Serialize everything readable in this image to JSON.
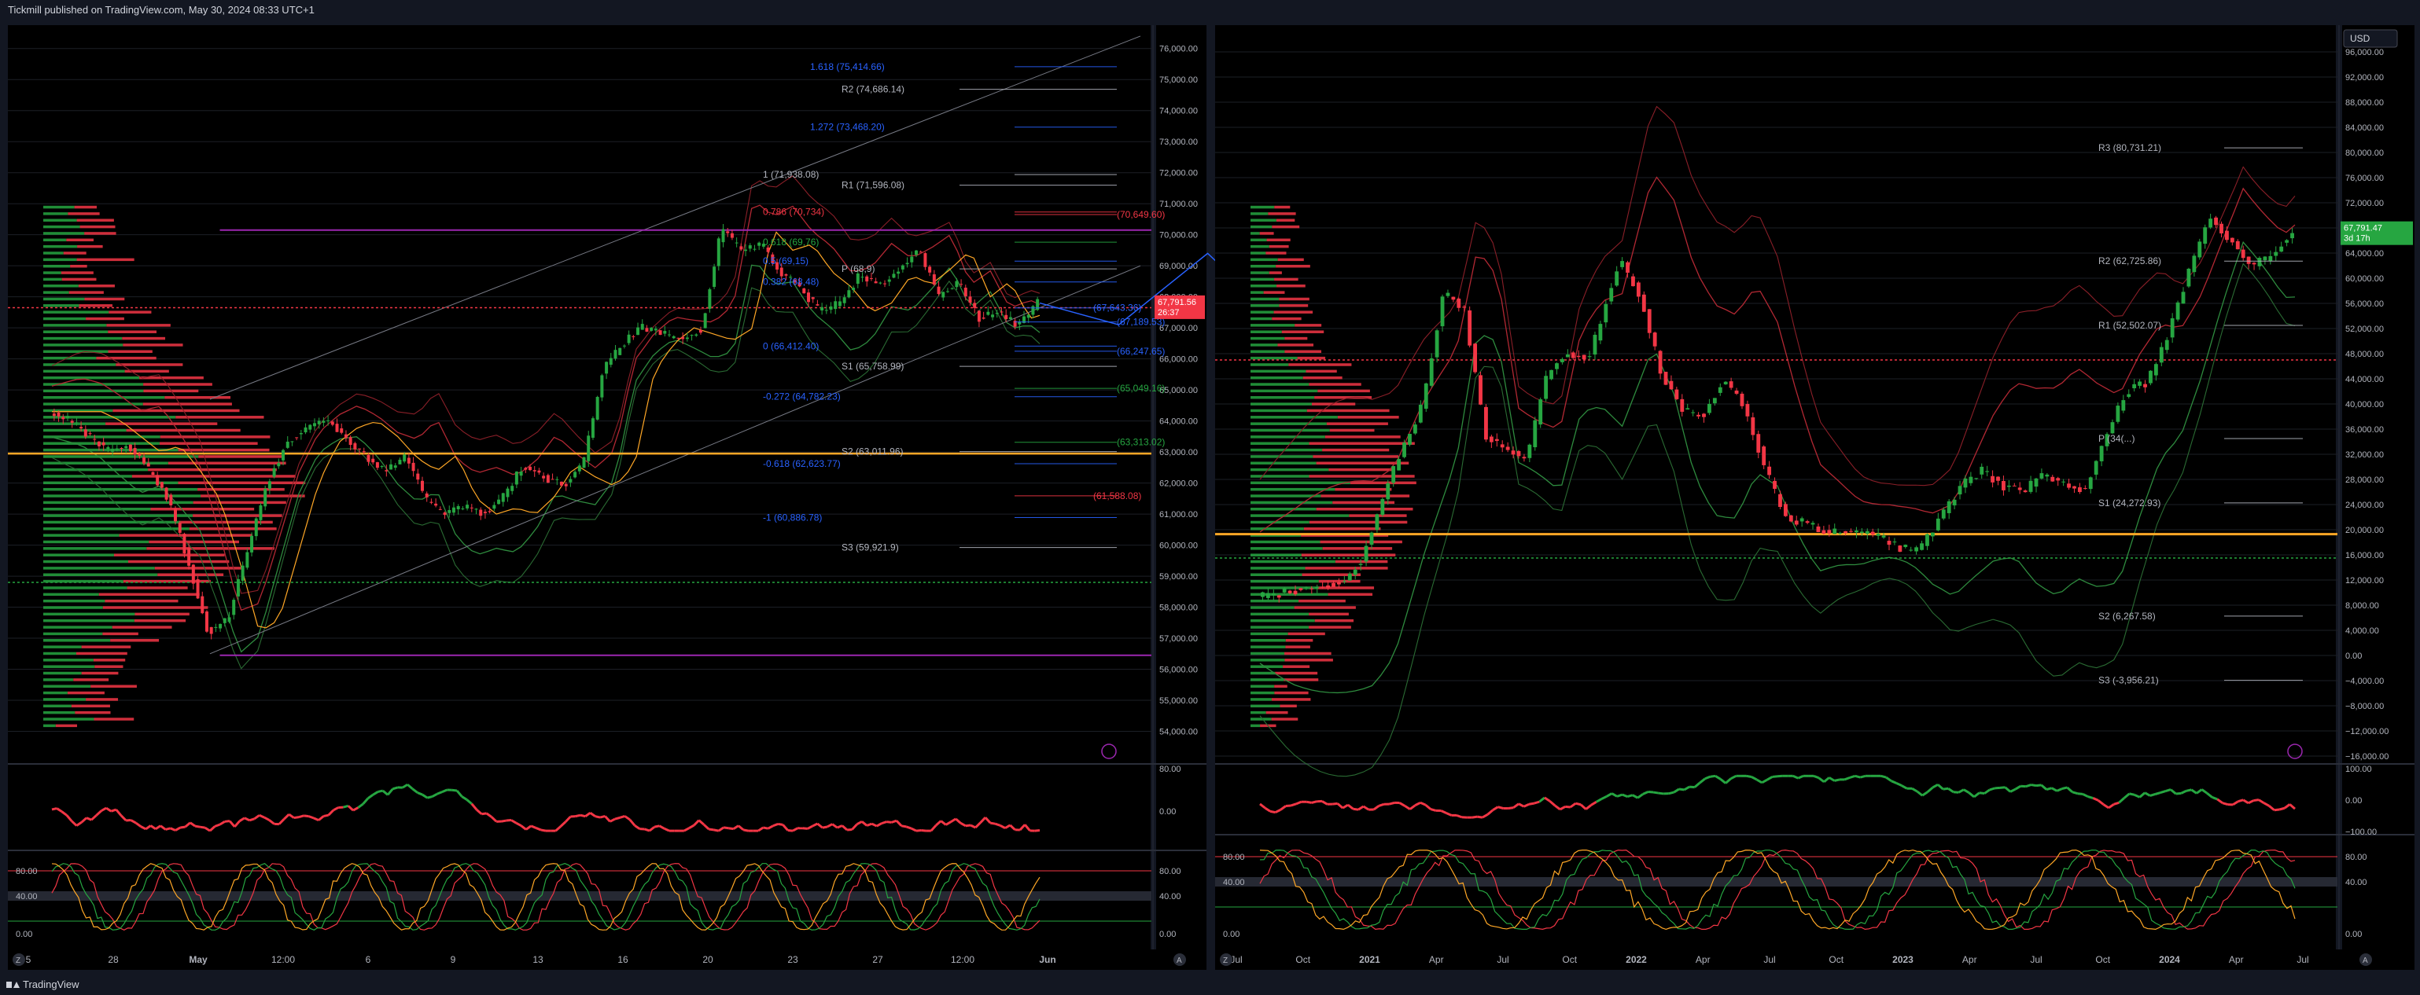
{
  "header": {
    "publisher": "Tickmill published on TradingView.com, May 30, 2024 08:33 UTC+1"
  },
  "footer": {
    "brand": "TradingView"
  },
  "colors": {
    "bg": "#000000",
    "up": "#26a641",
    "down": "#f23645",
    "grid": "#1c1f26",
    "axis_text": "#b2b5be",
    "fib": "#2962ff",
    "pivot": "#b2b5be",
    "channel": "#787b86",
    "purple": "#9c27b0",
    "orange": "#ffa726"
  },
  "chart_data": [
    {
      "name": "left-daily",
      "type": "line",
      "currency": "",
      "ylim": [
        53000,
        76500
      ],
      "y_ticks": [
        "76,000.00",
        "75,000.00",
        "74,000.00",
        "73,000.00",
        "72,000.00",
        "71,000.00",
        "70,000.00",
        "69,000.00",
        "68,000.00",
        "67,000.00",
        "66,000.00",
        "65,000.00",
        "64,000.00",
        "63,000.00",
        "62,000.00",
        "61,000.00",
        "60,000.00",
        "59,000.00",
        "58,000.00",
        "57,000.00",
        "56,000.00",
        "55,000.00",
        "54,000.00"
      ],
      "x_ticks": [
        "5",
        "28",
        "May",
        "12:00",
        "6",
        "9",
        "13",
        "16",
        "20",
        "23",
        "27",
        "12:00",
        "Jun"
      ],
      "last_price": {
        "value": 67791.56,
        "label": "67,791.56",
        "countdown": "26:37"
      },
      "price_path": [
        [
          0,
          64300
        ],
        [
          0.02,
          64000
        ],
        [
          0.04,
          63500
        ],
        [
          0.06,
          63000
        ],
        [
          0.08,
          63200
        ],
        [
          0.1,
          62400
        ],
        [
          0.12,
          61500
        ],
        [
          0.14,
          59500
        ],
        [
          0.16,
          57200
        ],
        [
          0.18,
          57600
        ],
        [
          0.2,
          59800
        ],
        [
          0.22,
          62000
        ],
        [
          0.24,
          63300
        ],
        [
          0.26,
          63800
        ],
        [
          0.28,
          64000
        ],
        [
          0.3,
          63500
        ],
        [
          0.32,
          62800
        ],
        [
          0.34,
          62400
        ],
        [
          0.36,
          62900
        ],
        [
          0.38,
          61500
        ],
        [
          0.4,
          61000
        ],
        [
          0.42,
          61200
        ],
        [
          0.44,
          61000
        ],
        [
          0.46,
          61600
        ],
        [
          0.48,
          62600
        ],
        [
          0.5,
          62200
        ],
        [
          0.52,
          61900
        ],
        [
          0.54,
          62600
        ],
        [
          0.56,
          65600
        ],
        [
          0.58,
          66500
        ],
        [
          0.6,
          67000
        ],
        [
          0.62,
          66800
        ],
        [
          0.64,
          66600
        ],
        [
          0.66,
          67000
        ],
        [
          0.68,
          70200
        ],
        [
          0.7,
          69500
        ],
        [
          0.72,
          69700
        ],
        [
          0.74,
          68800
        ],
        [
          0.76,
          68300
        ],
        [
          0.78,
          67500
        ],
        [
          0.8,
          67800
        ],
        [
          0.82,
          68700
        ],
        [
          0.84,
          68400
        ],
        [
          0.86,
          68900
        ],
        [
          0.88,
          69500
        ],
        [
          0.9,
          68000
        ],
        [
          0.92,
          68500
        ],
        [
          0.94,
          67300
        ],
        [
          0.96,
          67500
        ],
        [
          0.98,
          67100
        ],
        [
          1,
          67800
        ]
      ],
      "levels": [
        {
          "label": "1.618 (75,414.66)",
          "value": 75414.66,
          "kind": "fib"
        },
        {
          "label": "R2 (74,686.14)",
          "value": 74686.14,
          "kind": "pivot"
        },
        {
          "label": "1.272 (73,468.20)",
          "value": 73468.2,
          "kind": "fib"
        },
        {
          "label": "1 (71,938.08)",
          "value": 71938.08,
          "kind": "fib-main"
        },
        {
          "label": "R1 (71,596.08)",
          "value": 71596.08,
          "kind": "pivot"
        },
        {
          "label": "0.786 (70,734)",
          "value": 70734,
          "kind": "fib-red"
        },
        {
          "label": "(70,649.60)",
          "value": 70649.6,
          "kind": "red"
        },
        {
          "label": "0.618 (69,76)",
          "value": 69760,
          "kind": "fib-green"
        },
        {
          "label": "0.5 (69,15)",
          "value": 69150,
          "kind": "fib"
        },
        {
          "label": "P (68,9)",
          "value": 68900,
          "kind": "pivot"
        },
        {
          "label": "0.382 (68,48)",
          "value": 68480,
          "kind": "fib"
        },
        {
          "label": "(67,643.36)",
          "value": 67643.36,
          "kind": "blue"
        },
        {
          "label": "(67,189.53)",
          "value": 67189.53,
          "kind": "blue"
        },
        {
          "label": "0 (66,412.40)",
          "value": 66412.4,
          "kind": "fib"
        },
        {
          "label": "(66,247.65)",
          "value": 66247.65,
          "kind": "blue"
        },
        {
          "label": "S1 (65,758.99)",
          "value": 65758.99,
          "kind": "pivot"
        },
        {
          "label": "(65,049.16)",
          "value": 65049.16,
          "kind": "green"
        },
        {
          "label": "-0.272 (64,782.23)",
          "value": 64782.23,
          "kind": "fib"
        },
        {
          "label": "(63,313.02)",
          "value": 63313.02,
          "kind": "green"
        },
        {
          "label": "S2 (63,011.96)",
          "value": 63011.96,
          "kind": "pivot"
        },
        {
          "label": "-0.618 (62,623.77)",
          "value": 62623.77,
          "kind": "fib"
        },
        {
          "label": "(61,588.08)",
          "value": 61588.08,
          "kind": "red"
        },
        {
          "label": "-1 (60,886.78)",
          "value": 60886.78,
          "kind": "fib"
        },
        {
          "label": "S3 (59,921.9)",
          "value": 59921.9,
          "kind": "pivot"
        }
      ],
      "rsi": {
        "ticks": [
          "80.00",
          "0.00"
        ]
      },
      "stoch": {
        "ticks": [
          "80.00",
          "40.00",
          "0.00"
        ]
      },
      "footer_tags": [
        "Z",
        "A"
      ]
    },
    {
      "name": "right-weekly",
      "type": "line",
      "currency": "USD",
      "ylim": [
        -17000,
        99000
      ],
      "y_ticks": [
        "96,000.00",
        "92,000.00",
        "88,000.00",
        "84,000.00",
        "80,000.00",
        "76,000.00",
        "72,000.00",
        "68,000.00",
        "64,000.00",
        "60,000.00",
        "56,000.00",
        "52,000.00",
        "48,000.00",
        "44,000.00",
        "40,000.00",
        "36,000.00",
        "32,000.00",
        "28,000.00",
        "24,000.00",
        "20,000.00",
        "16,000.00",
        "12,000.00",
        "8,000.00",
        "4,000.00",
        "0.00",
        "−4,000.00",
        "−8,000.00",
        "−12,000.00",
        "−16,000.00"
      ],
      "x_ticks": [
        "Jul",
        "Oct",
        "2021",
        "Apr",
        "Jul",
        "Oct",
        "2022",
        "Apr",
        "Jul",
        "Oct",
        "2023",
        "Apr",
        "Jul",
        "Oct",
        "2024",
        "Apr",
        "Jul"
      ],
      "last_price": {
        "value": 67791.47,
        "label": "67,791.47",
        "countdown": "3d 17h"
      },
      "price_path": [
        [
          0,
          9200
        ],
        [
          0.04,
          10500
        ],
        [
          0.08,
          11500
        ],
        [
          0.1,
          15000
        ],
        [
          0.13,
          29000
        ],
        [
          0.16,
          40000
        ],
        [
          0.18,
          58000
        ],
        [
          0.2,
          55000
        ],
        [
          0.22,
          35000
        ],
        [
          0.24,
          33000
        ],
        [
          0.26,
          31000
        ],
        [
          0.28,
          45000
        ],
        [
          0.3,
          48000
        ],
        [
          0.32,
          47000
        ],
        [
          0.35,
          63000
        ],
        [
          0.37,
          57000
        ],
        [
          0.39,
          45000
        ],
        [
          0.41,
          39000
        ],
        [
          0.43,
          38000
        ],
        [
          0.45,
          44000
        ],
        [
          0.47,
          40000
        ],
        [
          0.49,
          30000
        ],
        [
          0.51,
          22000
        ],
        [
          0.53,
          21000
        ],
        [
          0.55,
          19500
        ],
        [
          0.58,
          19800
        ],
        [
          0.6,
          19000
        ],
        [
          0.62,
          17000
        ],
        [
          0.64,
          16800
        ],
        [
          0.66,
          22000
        ],
        [
          0.68,
          27000
        ],
        [
          0.7,
          29500
        ],
        [
          0.72,
          27000
        ],
        [
          0.74,
          26000
        ],
        [
          0.76,
          29000
        ],
        [
          0.78,
          27000
        ],
        [
          0.8,
          26500
        ],
        [
          0.82,
          35000
        ],
        [
          0.84,
          42000
        ],
        [
          0.86,
          43500
        ],
        [
          0.88,
          51000
        ],
        [
          0.9,
          61000
        ],
        [
          0.92,
          70000
        ],
        [
          0.94,
          66000
        ],
        [
          0.96,
          62000
        ],
        [
          0.98,
          63500
        ],
        [
          1,
          67800
        ]
      ],
      "levels": [
        {
          "label": "R3 (80,731.21)",
          "value": 80731.21,
          "kind": "pivot"
        },
        {
          "label": "R2 (62,725.86)",
          "value": 62725.86,
          "kind": "pivot"
        },
        {
          "label": "R1 (52,502.07)",
          "value": 52502.07,
          "kind": "pivot"
        },
        {
          "label": "P (34(...)",
          "value": 34500,
          "kind": "pivot"
        },
        {
          "label": "S1 (24,272.93)",
          "value": 24272.93,
          "kind": "pivot"
        },
        {
          "label": "S2 (6,267.58)",
          "value": 6267.58,
          "kind": "pivot"
        },
        {
          "label": "S3 (-3,956.21)",
          "value": -3956.21,
          "kind": "pivot"
        }
      ],
      "rsi": {
        "ticks": [
          "100.00",
          "0.00",
          "−100.00"
        ]
      },
      "stoch": {
        "ticks": [
          "80.00",
          "40.00",
          "0.00"
        ]
      },
      "footer_tags": [
        "Z",
        "A"
      ]
    }
  ]
}
